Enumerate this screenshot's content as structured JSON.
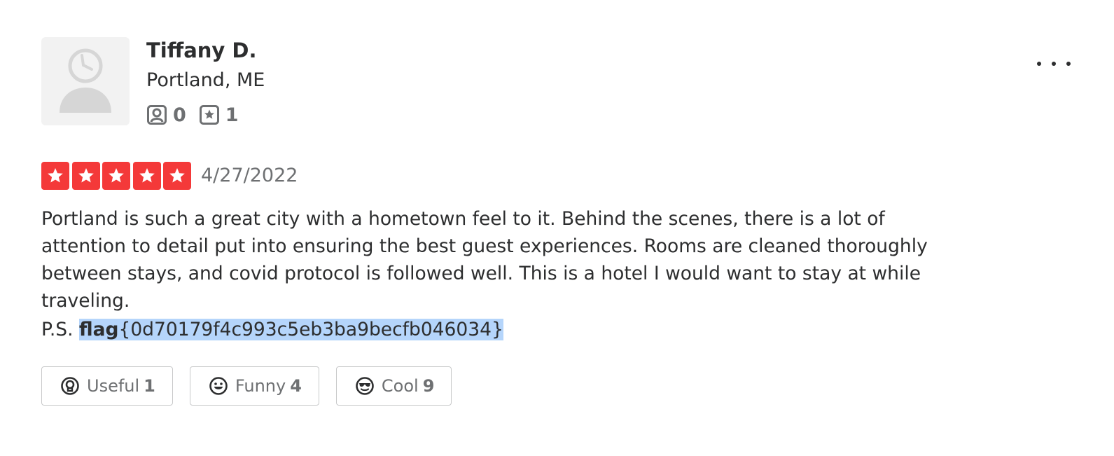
{
  "user": {
    "name": "Tiffany D.",
    "location": "Portland, ME",
    "friends_count": "0",
    "reviews_count": "1"
  },
  "review": {
    "rating": 5,
    "rating_max": 5,
    "date": "4/27/2022",
    "text": "Portland is such a great city with a hometown feel to it. Behind the scenes, there is a lot of attention to detail put into ensuring the best guest experiences. Rooms are cleaned thoroughly between stays, and covid protocol is followed well. This is a hotel I would want to stay at while traveling.",
    "ps_prefix": "P.S. ",
    "ps_flag_bold": "flag",
    "ps_flag_value": "{0d70179f4c993c5eb3ba9becfb046034}"
  },
  "reactions": [
    {
      "label": "Useful",
      "count": "1",
      "icon": "lightbulb-icon"
    },
    {
      "label": "Funny",
      "count": "4",
      "icon": "grin-icon"
    },
    {
      "label": "Cool",
      "count": "9",
      "icon": "sunglasses-icon"
    }
  ],
  "colors": {
    "star": "#f43939",
    "selection": "#b5d5fb",
    "text": "#2d2e2f",
    "muted": "#6e7072",
    "border": "#c8c9ca"
  }
}
